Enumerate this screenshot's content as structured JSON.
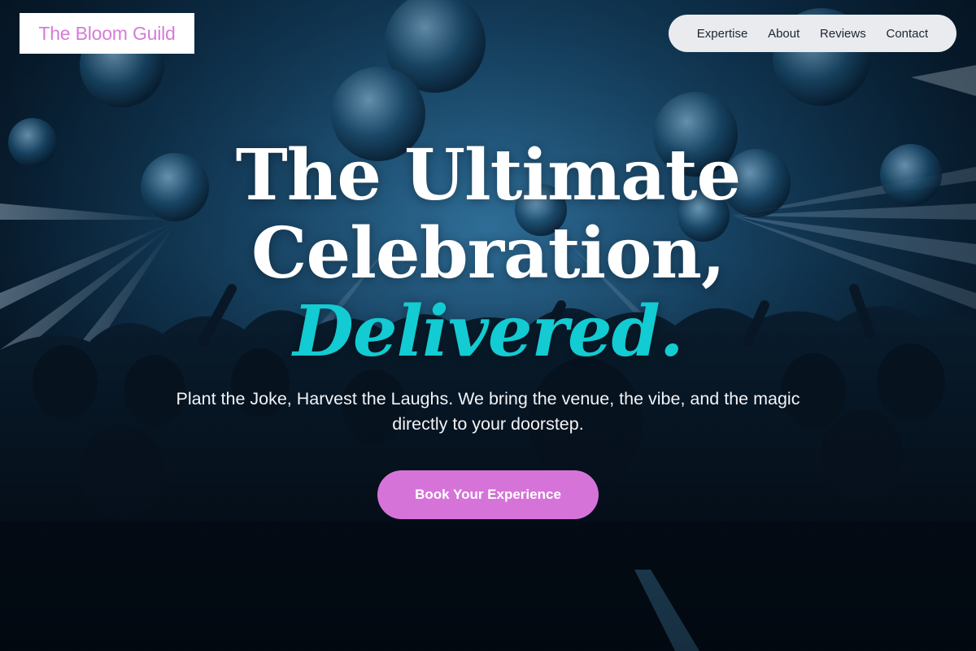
{
  "brand": {
    "name": "The Bloom Guild"
  },
  "nav": {
    "items": [
      "Expertise",
      "About",
      "Reviews",
      "Contact"
    ]
  },
  "hero": {
    "headline_line1": "The Ultimate",
    "headline_line2": "Celebration,",
    "headline_accent": "Delivered.",
    "subtitle": "Plant the Joke, Harvest the Laughs. We bring the venue, the vibe, and the magic directly to your doorstep.",
    "cta_label": "Book Your Experience",
    "background_image": "concert-crowd-with-disco-balls-and-light-beams"
  },
  "colors": {
    "brand_pink": "#d67bd8",
    "accent_cyan": "#13cbd2",
    "cta_bg": "#d673d9",
    "nav_bg": "#e9ebee"
  }
}
